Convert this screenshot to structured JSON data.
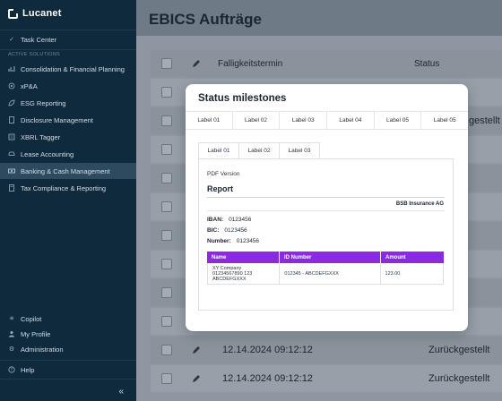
{
  "app": {
    "name": "Lucanet"
  },
  "sidebar": {
    "top_item": {
      "label": "Task Center",
      "icon": "check-icon"
    },
    "section_label": "ACTIVE SOLUTIONS",
    "items": [
      {
        "label": "Consolidation & Financial Planning",
        "icon": "chart-icon"
      },
      {
        "label": "xP&A",
        "icon": "target-icon"
      },
      {
        "label": "ESG Reporting",
        "icon": "leaf-icon"
      },
      {
        "label": "Disclosure Management",
        "icon": "document-icon"
      },
      {
        "label": "XBRL Tagger",
        "icon": "tag-icon"
      },
      {
        "label": "Lease Accounting",
        "icon": "car-icon"
      },
      {
        "label": "Banking & Cash Management",
        "icon": "money-icon"
      },
      {
        "label": "Tax Compliance & Reporting",
        "icon": "calculator-icon"
      }
    ],
    "active_index": 6,
    "bottom_items": [
      {
        "label": "Copilot",
        "icon": "sparkle-icon"
      },
      {
        "label": "My Profile",
        "icon": "user-icon"
      },
      {
        "label": "Administration",
        "icon": "gear-icon"
      }
    ],
    "help": {
      "label": "Help",
      "icon": "help-icon"
    },
    "collapse": "«"
  },
  "main": {
    "title": "EBICS Aufträge",
    "table": {
      "headers": {
        "date": "Falligkeitstermin",
        "status": "Status"
      },
      "visible_rows": [
        {
          "date": "12.14.2024 09:12:12",
          "status": "Zurückgestellt"
        },
        {
          "date": "12.14.2024 09:12:12",
          "status": "Zurückgestellt"
        }
      ],
      "partial_status": "gestellt"
    }
  },
  "modal": {
    "title": "Status milestones",
    "outer_tabs": [
      "Label 01",
      "Label 02",
      "Label 03",
      "Label 04",
      "Label 05",
      "Label 05"
    ],
    "inner_tabs": [
      "Label 01",
      "Label 02",
      "Label 03"
    ],
    "document": {
      "version": "PDF Version",
      "title": "Report",
      "company": "BSB Insurance AG",
      "iban_label": "IBAN:",
      "iban_value": "0123456",
      "bic_label": "BIC:",
      "bic_value": "0123456",
      "number_label": "Number:",
      "number_value": "0123456",
      "table": {
        "headers": [
          "Name",
          "ID Number",
          "Amount"
        ],
        "rows": [
          [
            "XY Company\n01234567890 123\nABCDEFGXXX",
            "012345 - ABCDEFGXXX",
            "123.00"
          ]
        ]
      },
      "accent": "#8a2be2"
    }
  }
}
